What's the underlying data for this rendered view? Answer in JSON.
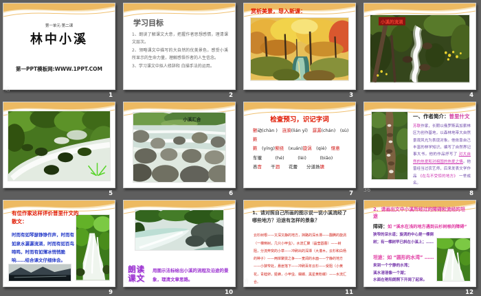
{
  "colors": {
    "viewer_background": "#5e5e5e",
    "wave_orange": "#edba62",
    "title_red": "#e01800",
    "body_red": "#cf1d14",
    "magenta": "#cc2fb0",
    "pink_title": "#e03aa2",
    "purple": "#7334aa",
    "blue": "#2238c8",
    "wordart_purple": "#9a2fd0"
  },
  "slides": {
    "s1": {
      "number": "1",
      "unit": "第一单元·第二课",
      "title": "林中小溪",
      "footer": "第一PPT模板网:WWW.1PPT.COM"
    },
    "s2": {
      "number": "2",
      "title": "学习目标",
      "item1": "1、朗读了解课文大意，把握作者思想感情，理清课文层次。",
      "item2": "2、领略课文中描写的大自然的优美景色，感受小溪所显示的生命力量，理解感悟作者的人生信念。",
      "item3": "3、学习课文中拟人修辞和 白描手法的运用。"
    },
    "s3": {
      "number": "3",
      "title": "赏析美景，导入新课："
    },
    "s4": {
      "number": "4",
      "caption": "小溪的流淌"
    },
    "s5": {
      "number": "5"
    },
    "s6": {
      "number": "6",
      "caption": "小溪汇合"
    },
    "s7": {
      "number": "7",
      "title": "检查预习，识记字词",
      "line1": [
        {
          "t": "颤",
          "c": "red"
        },
        {
          "t": "动(chàn )　"
        },
        {
          "t": "涟漪",
          "c": "red"
        },
        {
          "t": "(lián yī)　"
        },
        {
          "t": "潺潺",
          "c": "red"
        },
        {
          "t": "(chán)　(sù)"
        },
        {
          "t": "簌",
          "c": "red"
        }
      ],
      "line2": [
        {
          "t": "簌",
          "c": "red"
        },
        {
          "t": "　(yíng)"
        },
        {
          "t": "萦绕",
          "c": "red"
        },
        {
          "t": "　(xuán)"
        },
        {
          "t": "旋涡",
          "c": "red"
        },
        {
          "t": "　(qiè)　"
        },
        {
          "t": "惬意",
          "c": "red"
        }
      ],
      "line3": [
        {
          "t": "车辙　　　(hé)　　　(lèi)　　　(biāo)"
        }
      ],
      "line4": [
        {
          "t": "吝"
        },
        {
          "t": "啬",
          "c": "red"
        },
        {
          "t": "　　干"
        },
        {
          "t": "涸",
          "c": "red"
        },
        {
          "t": "　　花蕾　　分道扬"
        },
        {
          "t": "镳",
          "c": "red"
        }
      ]
    },
    "s8": {
      "number": "8",
      "title_prefix": "一、作者简介：",
      "author": "普里什文",
      "body": [
        {
          "t": "苏联",
          "c": "magenta"
        },
        {
          "t": "作家，长期以俄罗斯高加索林 区为创作基地，以森林地带大自然景观风光为表现对象。他依靠自己丰富的林学知识，编写了自然界记事大书。他的作品抒写了 "
        },
        {
          "t": "对大自然的热爱和对祖国的热爱之情",
          "c": "magenta-u"
        },
        {
          "t": "。他曾经当过农艺师，后来发表文学作品 "
        },
        {
          "t": "《在鸟不受惊的地方》",
          "c": "magenta"
        },
        {
          "t": " 一举成名。"
        }
      ]
    },
    "s9": {
      "number": "9",
      "title": "有位作家这样评价普里什文的散文：",
      "body": "时而有如琴瑟铮铮作声，时而有如泉水潺潺流淌，时而有如百鸟啼鸣，时而有如薄冰悄悄脆响……结合课文仔细体会。"
    },
    "s10": {
      "number": "10",
      "wordart": "朗读课文",
      "body": "用图示法标绘出小溪的流程及沿途的景象，理清文章思路。"
    },
    "s11": {
      "number": "11",
      "title": "1、请对照自己所画的图示说一说小溪流经了哪些地方？沿途有怎样的景象？",
      "body": "云杉树根——又深又静的地方，挡路的深水潭——翻腾的旋涡（一棵倒树，几只小甲虫），水流汇聚（晶莹圆蕾）——树阻，分流奔突的小草——冲刷出的深潭（大灌木，云杉和白杨的种子）——两岸聚拢之争——宽阔的水面——宁静的地方——小狭窄处，悬崖落下——冲刷百年云杉——受阻（小黄花，青蛙卵，姬蜂，小甲虫、蝴蝶、黑星黄粉蝶）——水流汇合。"
    },
    "s12": {
      "number": "12",
      "title": "2、请画出文中小溪所经过的障碍和流经的坦途",
      "obstacle_label": "障碍：",
      "obstacle_text": "如 “溪水在浅的地方遇到云杉树根的障碍”",
      "obstacle_detail": "狭窄的深水道；旋涡的中心是一棵倒树；有一棵树早已斜在小溪上；……",
      "smooth_label": "坦途：",
      "smooth_text": "如 “圆形的水湾” ……",
      "smooth_detail1": "来到一个宁静的水湾；",
      "smooth_detail2": "溪水溶溶像一个湖；",
      "smooth_detail3": "水面在艳阳朗照下开阔了起来。"
    }
  },
  "watermarks": {
    "w1": "诒",
    "w2": "36",
    "w3": "诒",
    "w4": "洽",
    "w5": "哈"
  }
}
